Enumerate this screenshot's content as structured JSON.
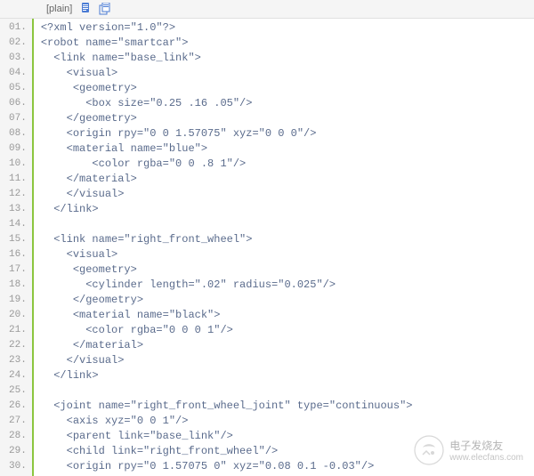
{
  "toolbar": {
    "view_mode": "[plain]",
    "copy_icon": "copy-icon",
    "new_icon": "new-window-icon"
  },
  "code": {
    "start_line": 1,
    "lines": [
      "<?xml version=\"1.0\"?>",
      "<robot name=\"smartcar\">",
      "  <link name=\"base_link\">",
      "    <visual>",
      "     <geometry>",
      "       <box size=\"0.25 .16 .05\"/>",
      "    </geometry>",
      "    <origin rpy=\"0 0 1.57075\" xyz=\"0 0 0\"/>",
      "    <material name=\"blue\">",
      "        <color rgba=\"0 0 .8 1\"/>",
      "    </material>",
      "    </visual>",
      "  </link>",
      "",
      "  <link name=\"right_front_wheel\">",
      "    <visual>",
      "     <geometry>",
      "       <cylinder length=\".02\" radius=\"0.025\"/>",
      "     </geometry>",
      "     <material name=\"black\">",
      "       <color rgba=\"0 0 0 1\"/>",
      "     </material>",
      "    </visual>",
      "  </link>",
      "",
      "  <joint name=\"right_front_wheel_joint\" type=\"continuous\">",
      "    <axis xyz=\"0 0 1\"/>",
      "    <parent link=\"base_link\"/>",
      "    <child link=\"right_front_wheel\"/>",
      "    <origin rpy=\"0 1.57075 0\" xyz=\"0.08 0.1 -0.03\"/>"
    ]
  },
  "watermark": {
    "brand_cn": "电子发烧友",
    "url": "www.elecfans.com"
  }
}
